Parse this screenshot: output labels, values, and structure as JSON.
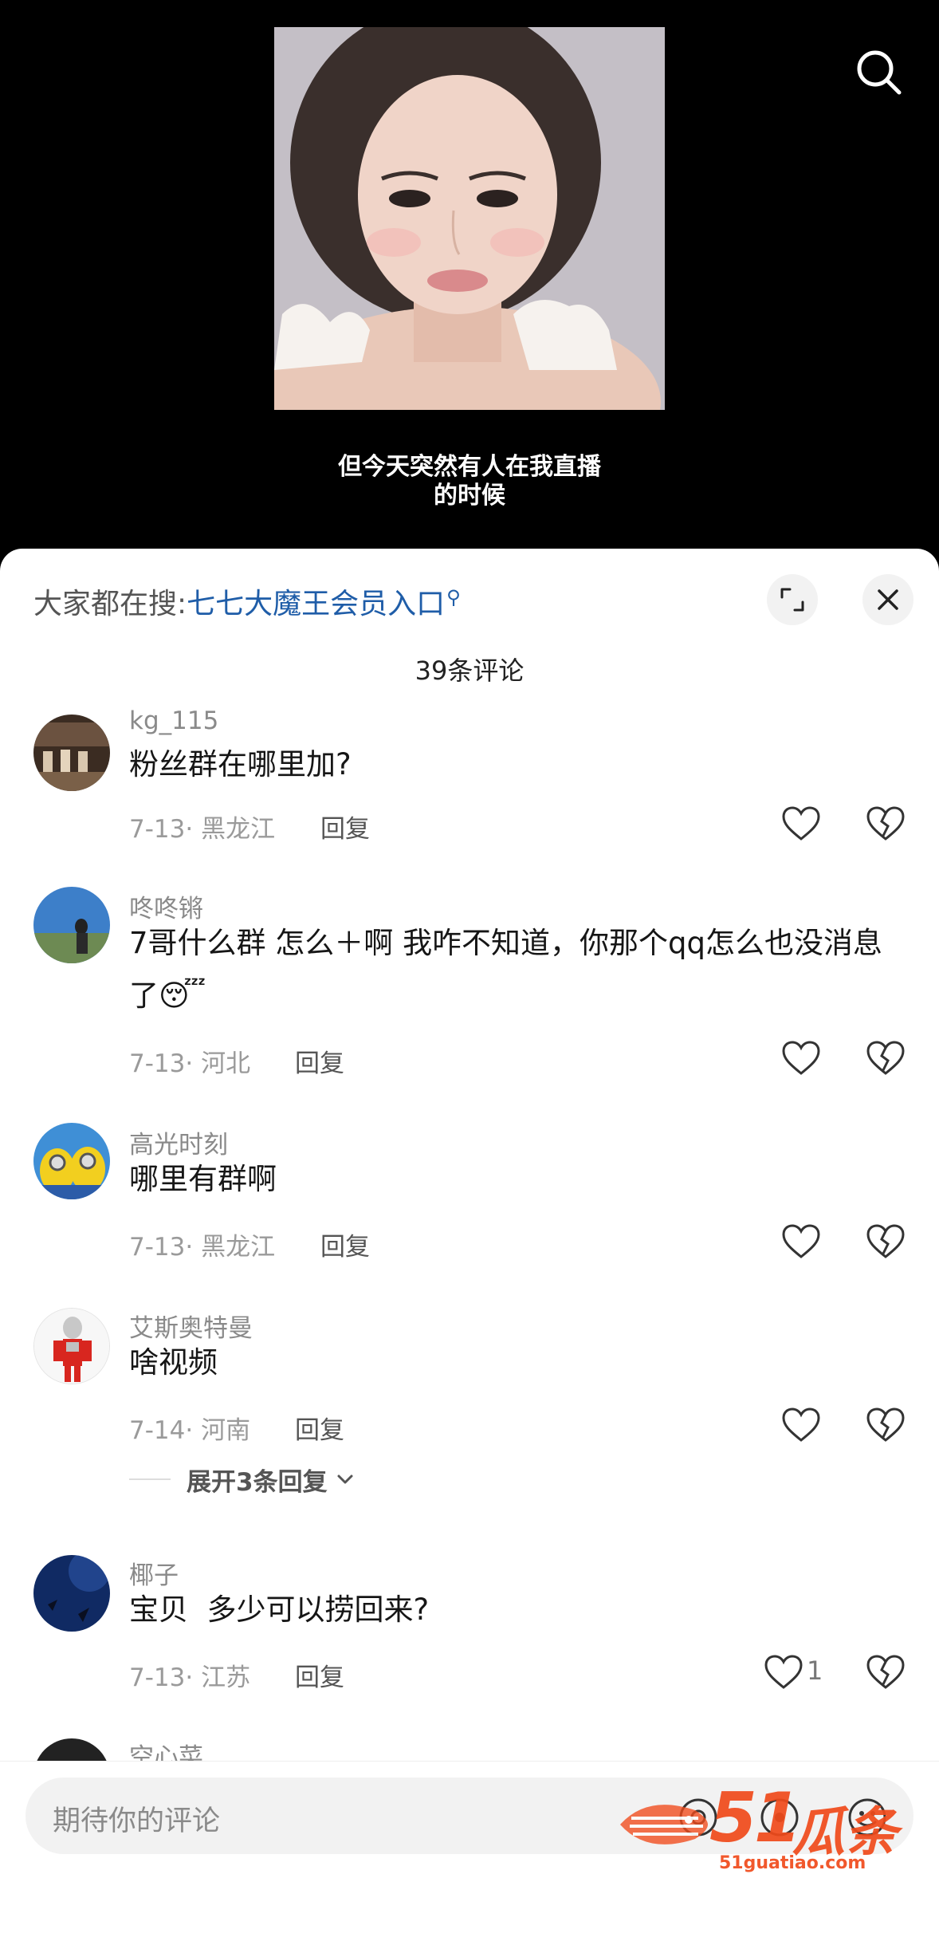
{
  "video": {
    "subtitle_line1": "但今天突然有人在我直播",
    "subtitle_line2": "的时候"
  },
  "header": {
    "hot_search_prefix": "大家都在搜:",
    "hot_search_keyword": "七七大魔王会员入口",
    "search_icon": "search-icon",
    "expand_icon": "expand-icon",
    "close_icon": "close-icon"
  },
  "comment_count": "39条评论",
  "comments": [
    {
      "name": "kg_115",
      "text": "粉丝群在哪里加?",
      "date": "7-13",
      "region": "黑龙江",
      "reply": "回复"
    },
    {
      "name": "咚咚锵",
      "text": "7哥什么群 怎么＋啊 我咋不知道，你那个qq怎么也没消息了😴",
      "date": "7-13",
      "region": "河北",
      "reply": "回复"
    },
    {
      "name": "高光时刻",
      "text": "哪里有群啊",
      "date": "7-13",
      "region": "黑龙江",
      "reply": "回复"
    },
    {
      "name": "艾斯奥特曼",
      "text": "啥视频",
      "date": "7-14",
      "region": "河南",
      "reply": "回复"
    },
    {
      "name": "椰子",
      "text": "宝贝  多少可以捞回来?",
      "date": "7-13",
      "region": "江苏",
      "reply": "回复",
      "likes": "1"
    },
    {
      "name": "空心菜"
    }
  ],
  "expand_replies": "展开3条回复",
  "input": {
    "placeholder": "期待你的评论"
  },
  "watermark": {
    "number": "51",
    "brand": "瓜条",
    "url": "51guatiao.com"
  },
  "colors": {
    "keyword_blue": "#1f5da8",
    "watermark_orange": "#f04a1b"
  }
}
